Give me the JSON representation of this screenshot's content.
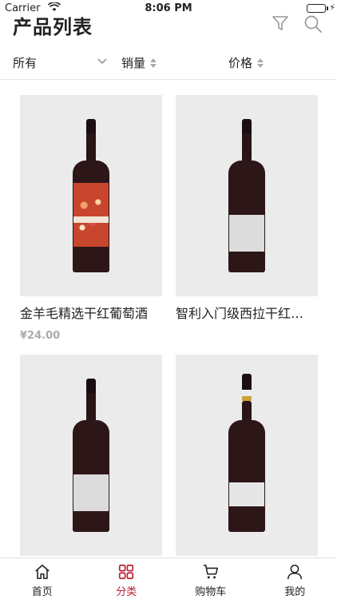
{
  "status_bar": {
    "carrier": "Carrier",
    "time": "8:06 PM"
  },
  "header": {
    "title": "产品列表",
    "filter_icon": "filter-icon",
    "search_icon": "search-icon"
  },
  "sort_bar": {
    "all_label": "所有",
    "sales_label": "销量",
    "price_label": "价格"
  },
  "products": [
    {
      "name": "金羊毛精选干红葡萄酒",
      "price": "¥24.00",
      "label_style": "art"
    },
    {
      "name": "智利入门级西拉干红…",
      "price": "",
      "label_style": "white"
    },
    {
      "name": "",
      "price": "",
      "label_style": "white"
    },
    {
      "name": "",
      "price": "",
      "label_style": "gold"
    }
  ],
  "tabbar": {
    "items": [
      {
        "label": "首页",
        "icon": "home-icon",
        "active": false
      },
      {
        "label": "分类",
        "icon": "category-grid-icon",
        "active": true
      },
      {
        "label": "购物车",
        "icon": "cart-icon",
        "active": false
      },
      {
        "label": "我的",
        "icon": "user-icon",
        "active": false
      }
    ]
  },
  "colors": {
    "accent": "#b81d34",
    "image_bg": "#ebebeb",
    "price": "#aaaaaa"
  }
}
